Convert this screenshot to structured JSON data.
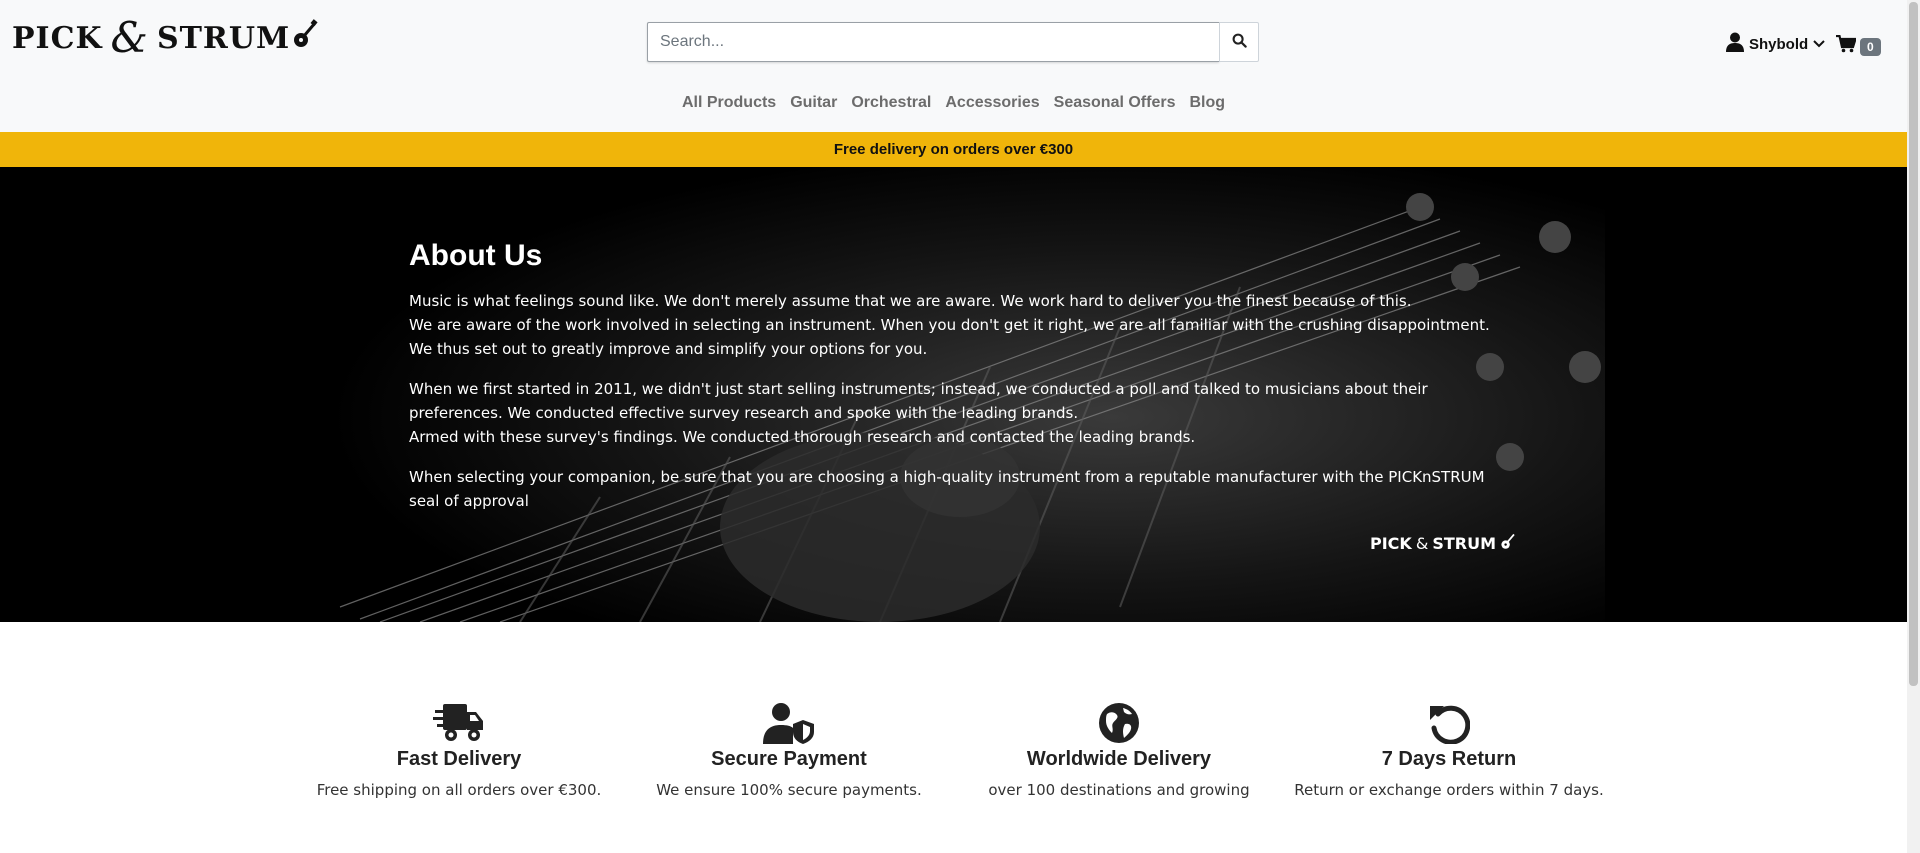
{
  "header": {
    "logo": {
      "left": "PICK",
      "amp": "&",
      "right": "STRUM"
    },
    "search": {
      "placeholder": "Search..."
    },
    "account": {
      "username": "Shybold"
    },
    "cart": {
      "count": "0"
    }
  },
  "nav": {
    "items": [
      {
        "label": "All Products"
      },
      {
        "label": "Guitar"
      },
      {
        "label": "Orchestral"
      },
      {
        "label": "Accessories"
      },
      {
        "label": "Seasonal Offers"
      },
      {
        "label": "Blog"
      }
    ]
  },
  "banner": {
    "text": "Free delivery on orders over €300"
  },
  "about": {
    "title": "About Us",
    "p1_line1": "Music is what feelings sound like. We don't merely assume that we are aware. We work hard to deliver you the finest because of this.",
    "p1_line2": "We are aware of the work involved in selecting an instrument. When you don't get it right, we are all familiar with the crushing disappointment.",
    "p1_line3": "We thus set out to greatly improve and simplify your options for you.",
    "p2_line1": "When we first started in 2011, we didn't just start selling instruments; instead, we conducted a poll and talked to musicians about their preferences. We conducted effective survey research and spoke with the leading brands.",
    "p2_line2": "Armed with these survey's findings. We conducted thorough research and contacted the leading brands.",
    "p3": "When selecting your companion, be sure that you are choosing a high-quality instrument from a reputable manufacturer with the PICKnSTRUM seal of approval",
    "signature": {
      "left": "PICK",
      "amp": "&",
      "right": "STRUM"
    }
  },
  "features": [
    {
      "icon": "truck-fast-icon",
      "title": "Fast Delivery",
      "text": "Free shipping on all orders over €300."
    },
    {
      "icon": "user-shield-icon",
      "title": "Secure Payment",
      "text": "We ensure 100% secure payments."
    },
    {
      "icon": "globe-icon",
      "title": "Worldwide Delivery",
      "text": "over 100 destinations and growing"
    },
    {
      "icon": "rotate-left-icon",
      "title": "7 Days Return",
      "text": "Return or exchange orders within 7 days."
    }
  ],
  "colors": {
    "banner": "#f0b50a",
    "header_bg": "#f8f9fa",
    "hero_bg": "#000000",
    "nav_text": "#6c6c6c"
  }
}
